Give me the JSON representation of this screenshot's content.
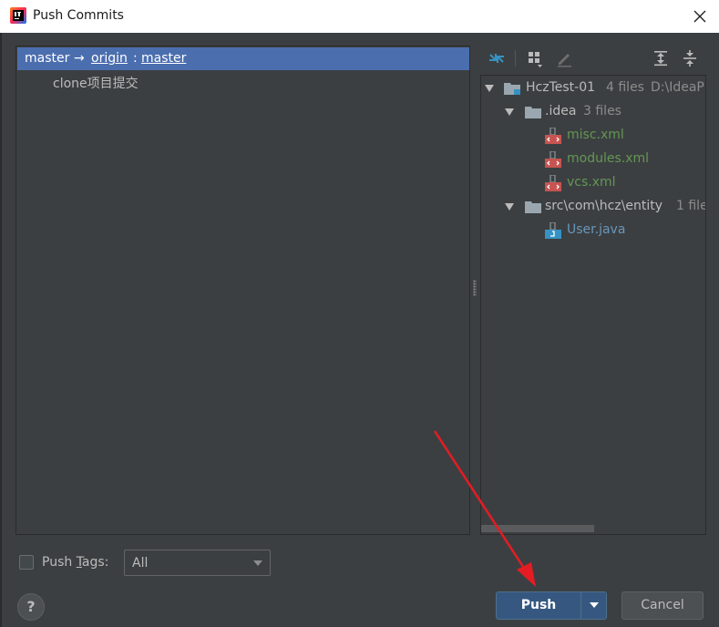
{
  "window": {
    "title": "Push Commits",
    "close_icon": "close-icon",
    "app_icon": "intellij-icon"
  },
  "branch_row": {
    "source": "master",
    "arrow": "→",
    "remote": "origin",
    "sep": ":",
    "target": "master"
  },
  "commits": [
    {
      "message": "clone项目提交"
    }
  ],
  "toolbar": {
    "icons": [
      "expand-commits-icon",
      "group-by-icon",
      "edit-icon",
      "expand-all-icon",
      "collapse-all-icon"
    ]
  },
  "file_tree": {
    "root": {
      "name": "HczTest-01",
      "count": "4 files",
      "path": "D:\\IdeaP"
    },
    "idea": {
      "name": ".idea",
      "count": "3 files",
      "files": [
        "misc.xml",
        "modules.xml",
        "vcs.xml"
      ]
    },
    "src": {
      "name": "src\\com\\hcz\\entity",
      "count": "1 file",
      "files": [
        "User.java"
      ]
    }
  },
  "footer": {
    "push_tags_label": "Push ",
    "push_tags_mnemonic": "T",
    "push_tags_rest": "ags:",
    "push_tags_checked": false,
    "tags_select_value": "All",
    "help_label": "?",
    "push_label": "Push",
    "cancel_label": "Cancel"
  },
  "colors": {
    "accent": "#4b6eaf",
    "push_button": "#365880",
    "xml_file": "#629755",
    "java_file": "#6897bb",
    "annotation_arrow": "#e51c23"
  }
}
